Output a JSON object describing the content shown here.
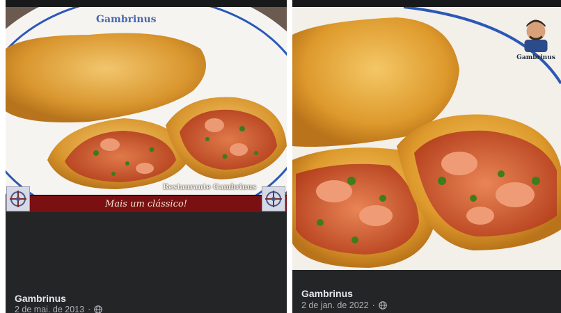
{
  "posts": [
    {
      "author": "Gambrinus",
      "date": "2 de mai. de 2013",
      "separator": "·",
      "banner_text": "Mais um clássico!",
      "watermark": "Restaurante Gambrinus",
      "plate_logo": "Gambrinus",
      "privacy_icon": "globe-icon"
    },
    {
      "author": "Gambrinus",
      "date": "2 de jan. de 2022",
      "separator": "·",
      "logo_text": "Gambrinus",
      "privacy_icon": "globe-icon"
    }
  ],
  "colors": {
    "background": "#18191a",
    "footer": "#242526",
    "author": "#e4e6eb",
    "meta": "#b0b3b8",
    "banner": "#7a1012"
  }
}
